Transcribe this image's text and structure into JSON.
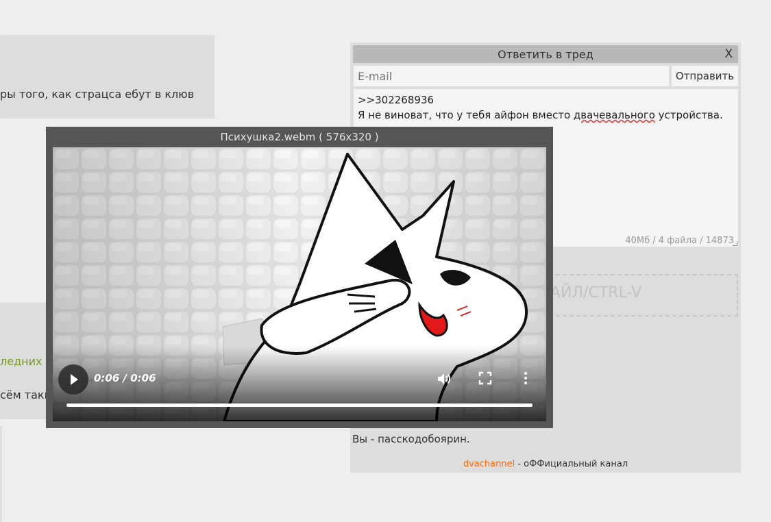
{
  "background_posts": {
    "post1_text": "ры того, как страцса ебут в клюв",
    "post2_green": "ледних",
    "post2_text": "сём таки"
  },
  "reply_form": {
    "title": "Ответить в тред",
    "close_label": "X",
    "email_placeholder": "E-mail",
    "submit_label": "Отправить",
    "message_line1": ">>302268936",
    "message_line2_before": "Я не виноват, что у тебя айфон вместо ",
    "message_line2_misspelled": "двачевального",
    "message_line2_after": " устройства.",
    "limits": "40Мб / 4 файла / 14873",
    "drop_text": "АЙЛ/CTRL-V",
    "passcode_text": "Вы - пасскодобоярин.",
    "footer_link": "dvachannel",
    "footer_text": " - оФФициальный канал"
  },
  "video_popup": {
    "title": "Психушка2.webm ( 576x320 )",
    "time": "0:06 / 0:06",
    "progress": 1.0,
    "icons": [
      "play-icon",
      "volume-icon",
      "fullscreen-icon",
      "more-icon"
    ]
  },
  "colors": {
    "greentext": "#789922",
    "link": "#ff6600",
    "misspell": "#e03030"
  }
}
